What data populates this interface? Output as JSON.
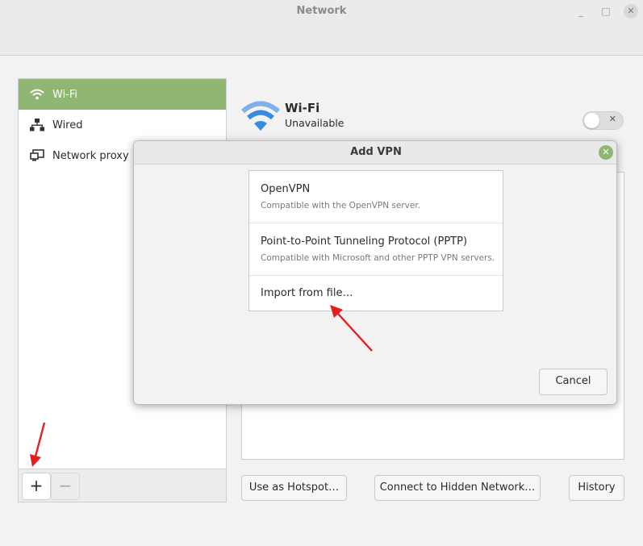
{
  "window": {
    "title": "Network",
    "minimize_glyph": "_",
    "maximize_glyph": "□",
    "close_glyph": "✕"
  },
  "sidebar": {
    "items": [
      {
        "label": "Wi-Fi",
        "icon": "wifi-icon",
        "active": true
      },
      {
        "label": "Wired",
        "icon": "wired-network-icon",
        "active": false
      },
      {
        "label": "Network proxy",
        "icon": "network-proxy-icon",
        "active": false
      }
    ],
    "add_glyph": "+",
    "remove_glyph": "−"
  },
  "wifi": {
    "title": "Wi-Fi",
    "status": "Unavailable",
    "toggle_glyph": "✕"
  },
  "buttons": {
    "hotspot": "Use as Hotspot…",
    "hidden_network": "Connect to Hidden Network…",
    "history": "History"
  },
  "dialog": {
    "title": "Add VPN",
    "close_glyph": "✕",
    "options": [
      {
        "name": "OpenVPN",
        "description": "Compatible with the OpenVPN server."
      },
      {
        "name": "Point-to-Point Tunneling Protocol (PPTP)",
        "description": "Compatible with Microsoft and other PPTP VPN servers."
      },
      {
        "name": "Import from file…",
        "description": ""
      }
    ],
    "cancel": "Cancel"
  },
  "colors": {
    "accent_green": "#8fb672",
    "wifi_blue": "#3a8be0",
    "annotation_red": "#e41d1d"
  }
}
